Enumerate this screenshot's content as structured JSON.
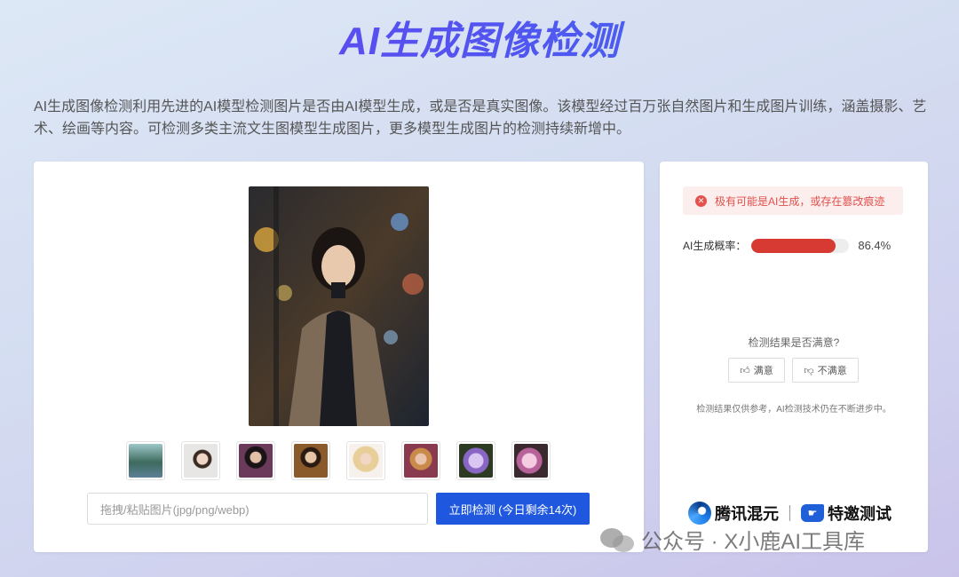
{
  "header": {
    "title": "AI生成图像检测"
  },
  "description": "AI生成图像检测利用先进的AI模型检测图片是否由AI模型生成，或是否是真实图像。该模型经过百万张自然图片和生成图片训练，涵盖摄影、艺术、绘画等内容。可检测多类主流文生图模型生成图片，更多模型生成图片的检测持续新增中。",
  "upload": {
    "placeholder": "拖拽/粘贴图片(jpg/png/webp)",
    "button_label": "立即检测 (今日剩余14次)"
  },
  "thumbnails": [
    {
      "name": "lake-scene"
    },
    {
      "name": "woman-light-bg"
    },
    {
      "name": "woman-dark-hair"
    },
    {
      "name": "woman-golden"
    },
    {
      "name": "blonde-woman"
    },
    {
      "name": "woman-pink"
    },
    {
      "name": "purple-flowers"
    },
    {
      "name": "pink-flowers"
    }
  ],
  "result": {
    "alert_text": "极有可能是AI生成，或存在篡改痕迹",
    "probability_label": "AI生成概率：",
    "probability_value": "86.4%",
    "probability_fraction": 0.864,
    "feedback_question": "检测结果是否满意?",
    "satisfied_label": "满意",
    "unsatisfied_label": "不满意",
    "note": "检测结果仅供参考，AI检测技术仍在不断进步中。",
    "brand_name": "腾讯混元",
    "brand_tag": "特邀测试"
  },
  "watermark": {
    "text": "公众号 · X小鹿AI工具库"
  },
  "colors": {
    "accent": "#1f58de",
    "danger": "#d63a33",
    "alert_bg": "#fdeeee"
  }
}
